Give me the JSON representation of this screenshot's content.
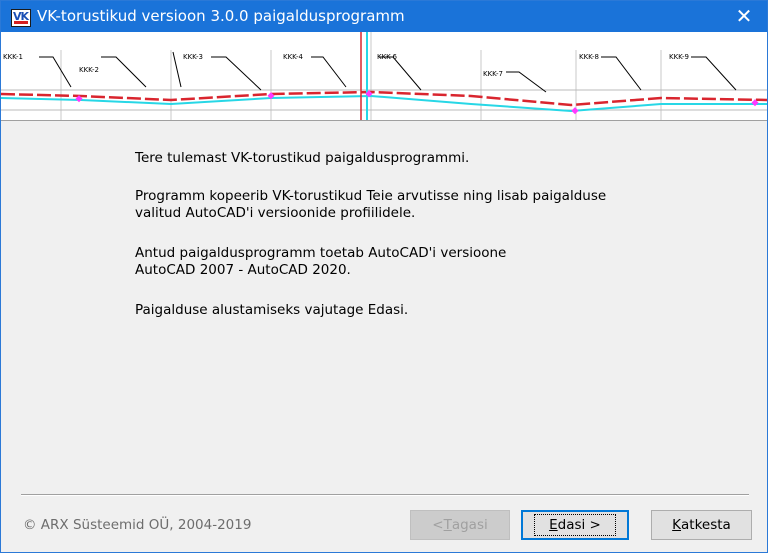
{
  "window": {
    "title": "VK-torustikud versioon 3.0.0 paigaldusprogramm",
    "close_glyph": "✕",
    "icon_text": "VK"
  },
  "banner": {
    "labels": [
      "KKK-1",
      "KKK-2",
      "KKK-3",
      "KKK-4",
      "KKK-6",
      "KKK-7",
      "KKK-8",
      "KKK-9"
    ]
  },
  "content": {
    "welcome": "Tere tulemast VK-torustikud paigaldusprogrammi.",
    "copy_line1": "Programm kopeerib VK-torustikud Teie arvutisse ning lisab paigalduse",
    "copy_line2": "valitud AutoCAD'i versioonide profiilidele.",
    "support_line1": "Antud paigaldusprogramm toetab AutoCAD'i versioone",
    "support_line2": "AutoCAD 2007 - AutoCAD 2020.",
    "start_hint": "Paigalduse alustamiseks vajutage Edasi."
  },
  "footer": {
    "copyright": "© ARX Süsteemid OÜ, 2004-2019",
    "back_prefix": "< ",
    "back_key": "T",
    "back_rest": "agasi",
    "next_key": "E",
    "next_rest": "dasi >",
    "cancel_key": "K",
    "cancel_rest": "atkesta"
  },
  "colors": {
    "titlebar": "#1a73d9",
    "accent": "#0078d7"
  }
}
